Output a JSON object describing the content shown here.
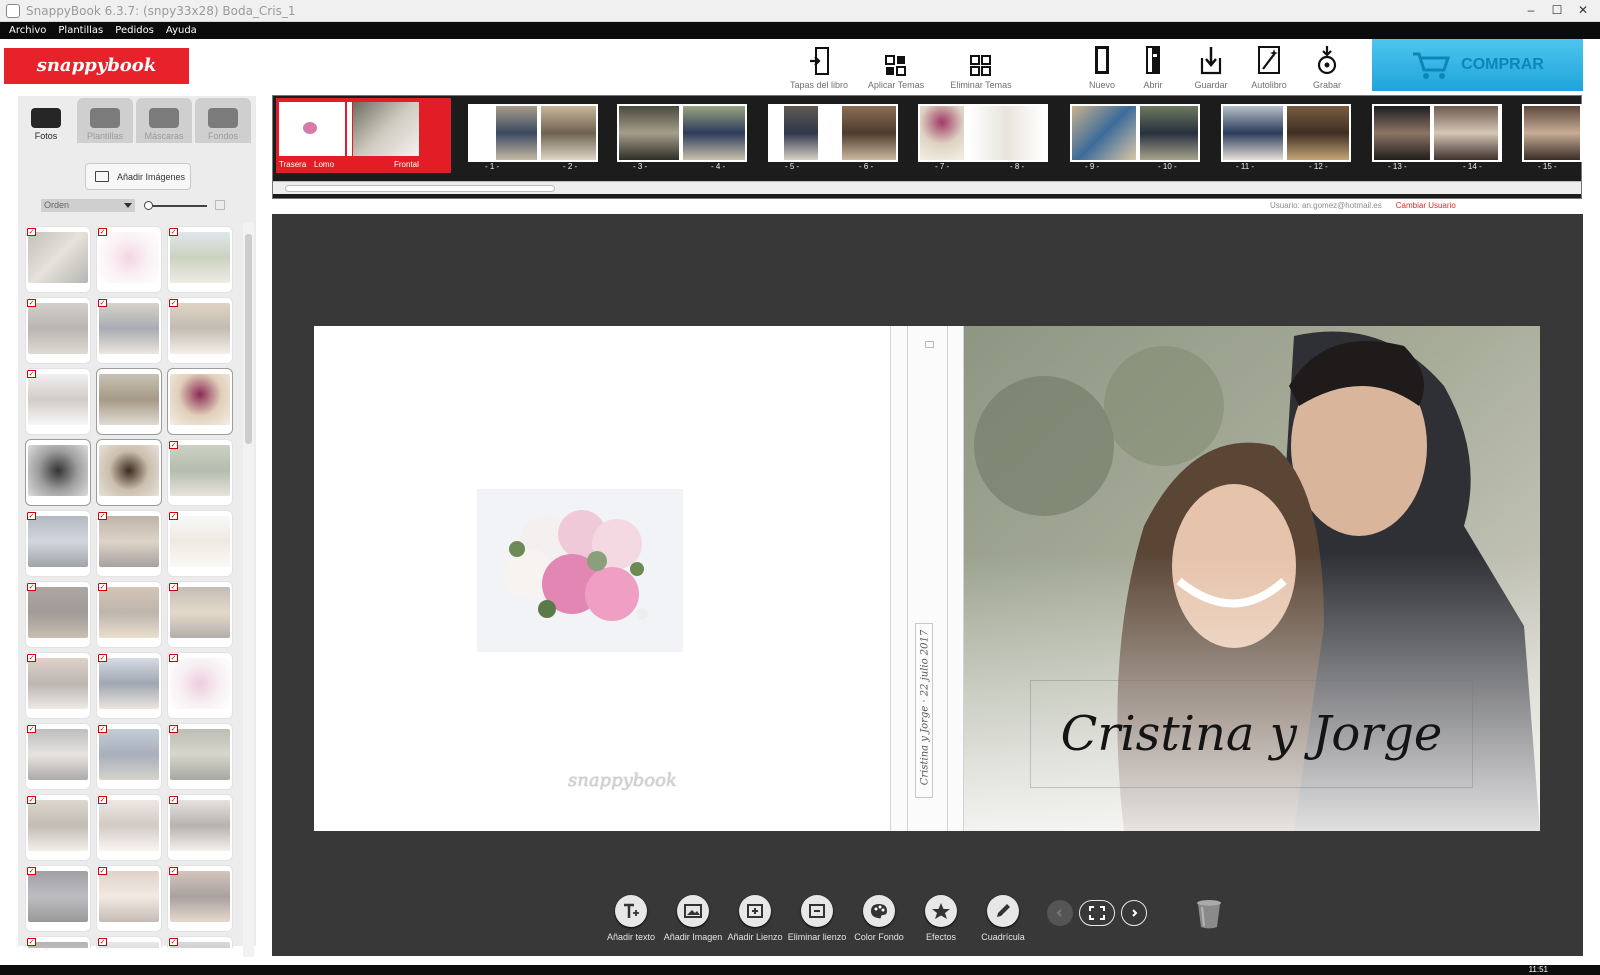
{
  "window": {
    "title": "SnappyBook 6.3.7: (snpy33x28) Boda_Cris_1"
  },
  "menu": [
    "Archivo",
    "Plantillas",
    "Pedidos",
    "Ayuda"
  ],
  "brand": {
    "logo_text": "snappybook",
    "accent": "#e8222b",
    "buy_color": "#29b3e6"
  },
  "toolbar": {
    "tapas": "Tapas del libro",
    "aplicar": "Aplicar Temas",
    "eliminar": "Eliminar Temas",
    "nuevo": "Nuevo",
    "abrir": "Abrir",
    "guardar": "Guardar",
    "autolibro": "Autolibro",
    "grabar": "Grabar",
    "comprar": "COMPRAR"
  },
  "left": {
    "tabs": [
      "Fotos",
      "Plantillas",
      "Máscaras",
      "Fondos"
    ],
    "active_tab": "Fotos",
    "add_images": "Añadir Imágenes",
    "sort_select": "Orden"
  },
  "filmstrip": {
    "cover_labels": {
      "back": "Trasera",
      "spine": "Lomo",
      "front": "Frontal"
    },
    "pages": [
      "- 1 -",
      "- 2 -",
      "- 3 -",
      "- 4 -",
      "- 5 -",
      "- 6 -",
      "- 7 -",
      "- 8 -",
      "- 9 -",
      "- 10 -",
      "- 11 -",
      "- 12 -",
      "- 13 -",
      "- 14 -",
      "- 15 -"
    ]
  },
  "user": {
    "label": "Usuario:",
    "email": "an.gomez@hotmail.es",
    "change": "Cambiar Usuario"
  },
  "design": {
    "cover_names": "Cristina y Jorge",
    "spine_text": "Cristina y Jorge · 22 julio 2017",
    "watermark": "snappybook"
  },
  "bottom": {
    "add_text": "Añadir texto",
    "add_image": "Añadir Imagen",
    "add_canvas": "Añadir Lienzo",
    "remove_canvas": "Eliminar lienzo",
    "bg_color": "Color Fondo",
    "effects": "Efectos",
    "grid": "Cuadrícula"
  },
  "taskbar": {
    "time": "11:51"
  }
}
